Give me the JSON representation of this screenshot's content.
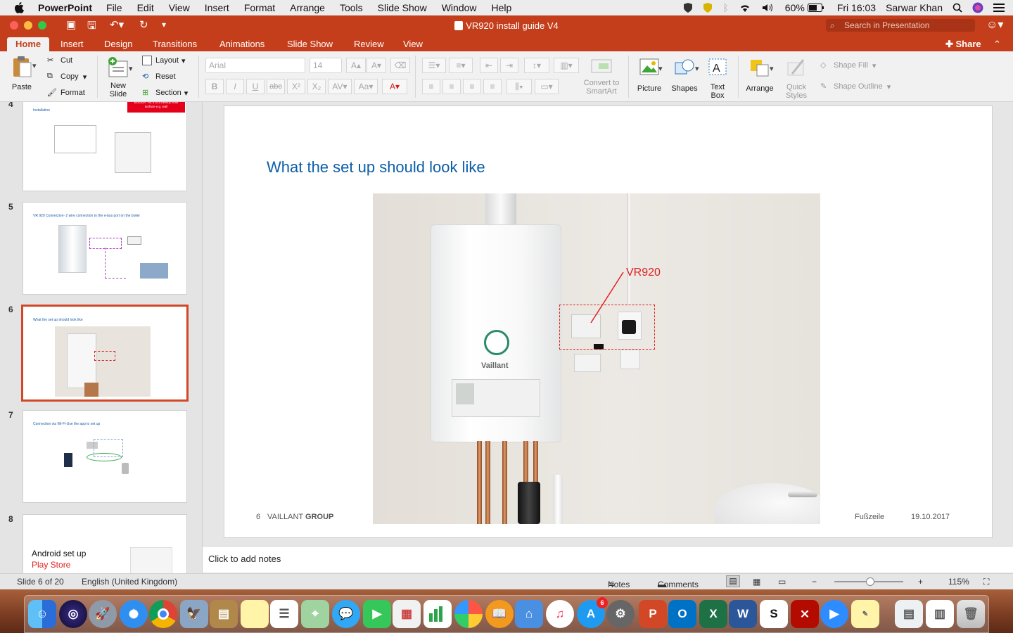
{
  "menubar": {
    "app_name": "PowerPoint",
    "items": [
      "File",
      "Edit",
      "View",
      "Insert",
      "Format",
      "Arrange",
      "Tools",
      "Slide Show",
      "Window",
      "Help"
    ],
    "battery": "60%",
    "clock": "Fri 16:03",
    "user": "Sarwar Khan"
  },
  "window": {
    "title": "VR920 install guide V4",
    "search_placeholder": "Search in Presentation"
  },
  "tabs": {
    "items": [
      "Home",
      "Insert",
      "Design",
      "Transitions",
      "Animations",
      "Slide Show",
      "Review",
      "View"
    ],
    "share": "Share"
  },
  "ribbon": {
    "paste": "Paste",
    "cut": "Cut",
    "copy": "Copy",
    "format": "Format",
    "new_slide_1": "New",
    "new_slide_2": "Slide",
    "layout": "Layout",
    "reset": "Reset",
    "section": "Section",
    "font_name": "Arial",
    "font_size": "14",
    "convert_1": "Convert to",
    "convert_2": "SmartArt",
    "picture": "Picture",
    "shapes": "Shapes",
    "textbox_1": "Text",
    "textbox_2": "Box",
    "arrange": "Arrange",
    "quick_1": "Quick",
    "quick_2": "Styles",
    "shape_fill": "Shape Fill",
    "shape_outline": "Shape Outline"
  },
  "thumbnails": [
    {
      "num": "4",
      "title": "Installation",
      "note": "DO NOT ATTACH THIS BOX TO THE BOILER. Fix it to a nearby solid surface e.g. wall"
    },
    {
      "num": "5",
      "title": "VR 920 Connection- 2 wire connection to the e-bus port on the boiler"
    },
    {
      "num": "6",
      "title": "What the set up should look like"
    },
    {
      "num": "7",
      "title": "Connection via Wi-Fi-Use the app to set up"
    },
    {
      "num": "8",
      "title_1": "Android set up",
      "title_2": "Play Store"
    }
  ],
  "slide": {
    "title": "What the set up should look like",
    "callout": "VR920",
    "footer_num": "6",
    "footer_company_a": "VAILLANT ",
    "footer_company_b": "GROUP",
    "footer_text": "Fußzeile",
    "footer_date": "19.10.2017",
    "boiler_brand": "Vaillant"
  },
  "notes": {
    "placeholder": "Click to add notes"
  },
  "status": {
    "slide_count": "Slide 6 of 20",
    "language": "English (United Kingdom)",
    "notes": "Notes",
    "comments": "Comments",
    "zoom": "115%"
  },
  "dock": {
    "badge": "6"
  },
  "colors": {
    "accent": "#c43e1c",
    "slide_title": "#0b5ea8",
    "callout": "#e02020"
  }
}
